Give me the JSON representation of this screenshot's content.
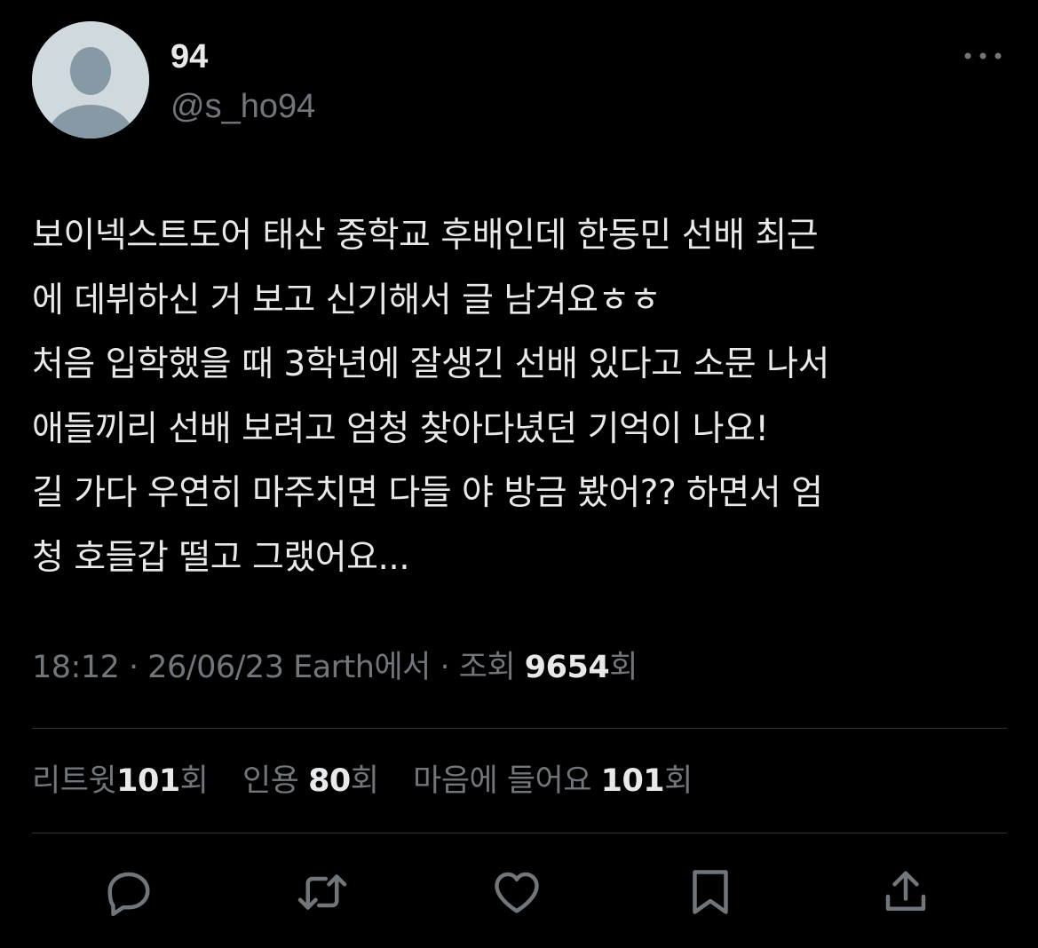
{
  "author": {
    "display_name": "94",
    "handle": "@s_ho94"
  },
  "tweet": {
    "lines": [
      "보이넥스트도어 태산 중학교 후배인데 한동민 선배 최근",
      "에 데뷔하신 거 보고 신기해서 글 남겨요ㅎㅎ",
      "처음 입학했을 때 3학년에 잘생긴 선배 있다고 소문 나서",
      "애들끼리 선배 보려고 엄청 찾아다녔던 기억이 나요!",
      "길 가다 우연히 마주치면 다들 야 방금 봤어?? 하면서 엄",
      "청 호들갑 떨고 그랬어요..."
    ]
  },
  "meta": {
    "time": "18:12",
    "sep": " · ",
    "date": "26/06/23",
    "source": "Earth에서",
    "views_label": "조회 ",
    "views_count": "9654",
    "views_suffix": "회"
  },
  "stats": {
    "retweets_label": "리트윗",
    "retweets_count": "101",
    "retweets_suffix": "회",
    "quotes_label": "인용",
    "quotes_count": "80",
    "quotes_suffix": "회",
    "likes_label": "마음에 들어요",
    "likes_count": "101",
    "likes_suffix": "회"
  },
  "icons": {
    "more": "more-horizontal-icon",
    "reply": "reply-icon",
    "retweet": "retweet-icon",
    "like": "heart-icon",
    "bookmark": "bookmark-icon",
    "share": "share-icon"
  },
  "colors": {
    "background": "#000000",
    "primary_text": "#e7e9ea",
    "secondary_text": "#71767b",
    "divider": "#2f3336",
    "avatar_bg": "#cfd9de",
    "avatar_figure": "#8899a6"
  }
}
